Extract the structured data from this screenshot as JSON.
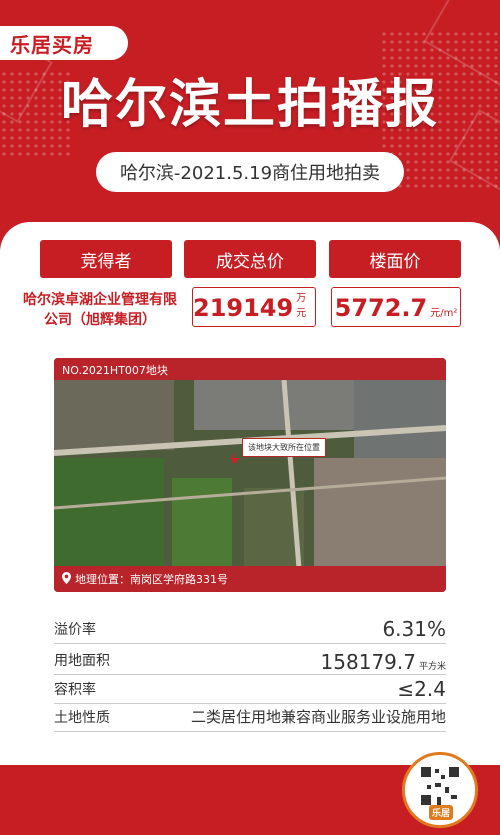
{
  "brand": {
    "logo_text": "乐居买房",
    "accent": "#c71e24",
    "badge_text": "乐居"
  },
  "header": {
    "title": "哈尔滨土拍播报",
    "subtitle": "哈尔滨-2021.5.19商住用地拍卖"
  },
  "summary": {
    "winner_label": "竞得者",
    "price_label": "成交总价",
    "unit_price_label": "楼面价",
    "winner_name": "哈尔滨卓湖企业管理有限公司（旭辉集团）",
    "total_price": "219149",
    "total_price_unit": "万元",
    "unit_price": "5772.7",
    "unit_price_unit": "元/m²"
  },
  "map": {
    "parcel_id": "NO.2021HT007地块",
    "callout": "该地块大致所在位置",
    "location": "地理位置：南岗区学府路331号",
    "pin_icon": "location-pin-icon"
  },
  "details": [
    {
      "label": "溢价率",
      "value": "6.31%",
      "unit": ""
    },
    {
      "label": "用地面积",
      "value": "158179.7",
      "unit": "平方米"
    },
    {
      "label": "容积率",
      "value": "≤2.4",
      "unit": ""
    },
    {
      "label": "土地性质",
      "value": "二类居住用地兼容商业服务业设施用地",
      "unit": ""
    }
  ]
}
